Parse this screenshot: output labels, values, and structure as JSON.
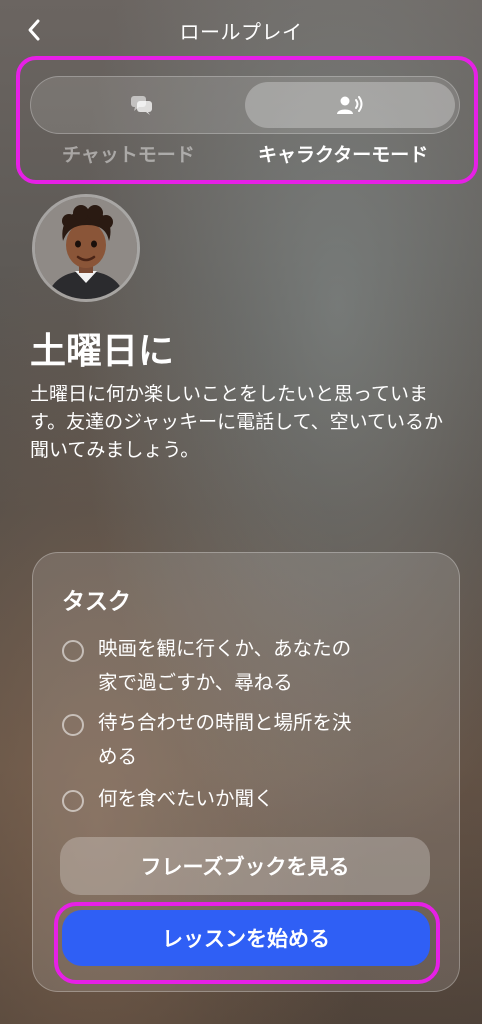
{
  "header": {
    "title": "ロールプレイ"
  },
  "mode_switch": {
    "chat_label": "チャットモード",
    "character_label": "キャラクターモード",
    "selected": "character"
  },
  "scenario": {
    "title": "土曜日に",
    "description": "土曜日に何か楽しいことをしたいと思っています。友達のジャッキーに電話して、空いているか聞いてみましょう。"
  },
  "tasks": {
    "title": "タスク",
    "items": [
      {
        "line1": "映画を観に行くか、あなたの",
        "line2": "家で過ごすか、尋ねる"
      },
      {
        "line1": "待ち合わせの時間と場所を決",
        "line2": "める"
      },
      {
        "line1": "何を食べたいか聞く",
        "line2": ""
      }
    ]
  },
  "buttons": {
    "phrasebook": "フレーズブックを見る",
    "start_lesson": "レッスンを始める"
  },
  "colors": {
    "accent": "#2f5ff5",
    "annotation": "#e620e6"
  }
}
